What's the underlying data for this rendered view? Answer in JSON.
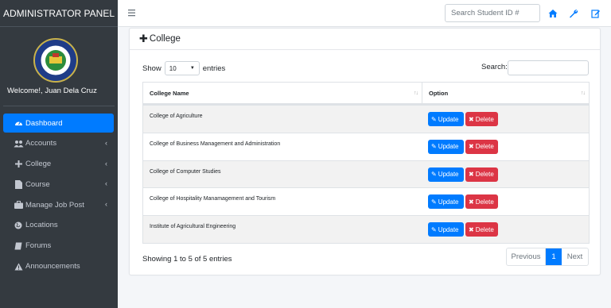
{
  "sidebar": {
    "brand": "ADMINISTRATOR PANEL",
    "welcome": "Welcome!, Juan Dela Cruz",
    "items": [
      {
        "label": "Dashboard",
        "icon": "tachometer-icon",
        "active": true,
        "has_arrow": false
      },
      {
        "label": "Accounts",
        "icon": "users-icon",
        "active": false,
        "has_arrow": true
      },
      {
        "label": "College",
        "icon": "plus-icon",
        "active": false,
        "has_arrow": true
      },
      {
        "label": "Course",
        "icon": "file-icon",
        "active": false,
        "has_arrow": true
      },
      {
        "label": "Manage Job Post",
        "icon": "briefcase-icon",
        "active": false,
        "has_arrow": true
      },
      {
        "label": "Locations",
        "icon": "globe-icon",
        "active": false,
        "has_arrow": false
      },
      {
        "label": "Forums",
        "icon": "book-icon",
        "active": false,
        "has_arrow": false
      },
      {
        "label": "Announcements",
        "icon": "warning-icon",
        "active": false,
        "has_arrow": false
      }
    ]
  },
  "topbar": {
    "search_placeholder": "Search Student ID #"
  },
  "card": {
    "title": "College",
    "show_label": "Show",
    "entries_value": "10",
    "entries_label": "entries",
    "search_label": "Search:",
    "columns": [
      "College Name",
      "Option"
    ],
    "rows": [
      "College of Agriculture",
      "College of Business Management and Administration",
      "College of Computer Studies",
      "College of Hospitality Manamagement and Tourism",
      "Institute of Agricultural Engineering"
    ],
    "update_label": "Update",
    "delete_label": "Delete",
    "info": "Showing 1 to 5 of 5 entries",
    "pager": {
      "prev": "Previous",
      "page": "1",
      "next": "Next"
    }
  },
  "colors": {
    "sidebar_bg": "#343a40",
    "primary": "#007bff",
    "danger": "#dc3545"
  }
}
